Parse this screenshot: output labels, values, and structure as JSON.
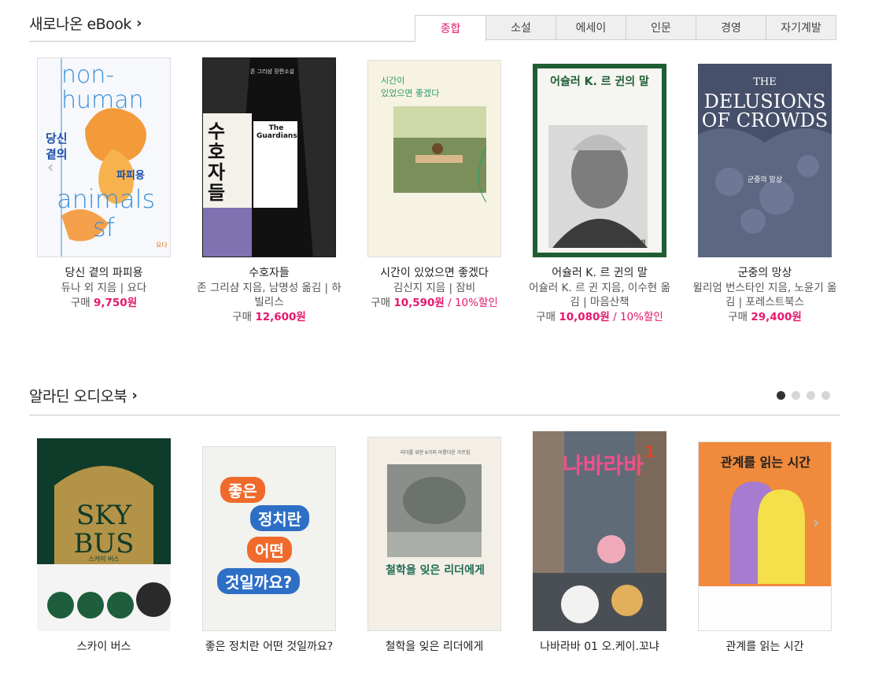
{
  "ebook": {
    "title": "새로나온 eBook",
    "tabs": [
      "종합",
      "소설",
      "에세이",
      "인문",
      "경영",
      "자기계발"
    ],
    "books": [
      {
        "title": "당신 곁의 파피용",
        "author": "듀나 외 지음 | 요다",
        "price_label": "구매",
        "price": "9,750원",
        "discount": ""
      },
      {
        "title": "수호자들",
        "author": "존 그리샴 지음, 남명성 옮김 | 하빌리스",
        "price_label": "구매",
        "price": "12,600원",
        "discount": ""
      },
      {
        "title": "시간이 있었으면 좋겠다",
        "author": "김신지 지음 | 잠비",
        "price_label": "구매",
        "price": "10,590원",
        "discount": " / 10%할인"
      },
      {
        "title": "어슐러 K. 르 귄의 말",
        "author": "어슐러 K. 르 귄 지음, 이수현 옮김 | 마음산책",
        "price_label": "구매",
        "price": "10,080원",
        "discount": " / 10%할인"
      },
      {
        "title": "군중의 망상",
        "author": "윌리엄 번스타인 지음, 노윤기 옮김 | 포레스트북스",
        "price_label": "구매",
        "price": "29,400원",
        "discount": ""
      }
    ],
    "covers": {
      "c1": {
        "lines": [
          "non-",
          "human",
          "당신",
          "곁의",
          "파피용",
          "animals",
          "sf"
        ],
        "brand": "요다"
      },
      "c2": {
        "top": "존 그리샴 장편소설",
        "big": "수호자들",
        "en": "The Guardians"
      },
      "c3": {
        "a": "시간이",
        "b": "있었으면 좋겠다"
      },
      "c4": {
        "t": "어슐러 K. 르 귄의 말",
        "pub": "마음산책"
      },
      "c5": {
        "l1": "THE",
        "l2": "DELUSIONS",
        "l3": "OF CROWDS",
        "ko": "군중의 망상"
      }
    }
  },
  "audio": {
    "title": "알라딘 오디오북",
    "books": [
      {
        "title": "스카이 버스"
      },
      {
        "title": "좋은 정치란 어떤 것일까요?"
      },
      {
        "title": "철학을 잊은 리더에게"
      },
      {
        "title": "나바라바 01 오.케이.꼬냐"
      },
      {
        "title": "관계를 읽는 시간"
      }
    ],
    "covers": {
      "a1": {
        "l1": "SKY",
        "l2": "BUS",
        "sub": "스카이 버스"
      },
      "a2": {
        "w1": "좋은",
        "w2": "정치란",
        "w3": "어떤",
        "w4": "것일까요?"
      },
      "a3": {
        "top": "리더를 위한 6가지 아름다운 가르침",
        "t": "철학을 잊은 리더에게"
      },
      "a4": {
        "t": "나바라바",
        "n": "1"
      },
      "a5": {
        "t": "관계를 읽는 시간"
      }
    }
  },
  "colors": {
    "accent": "#e4186d",
    "dot_active": "#333333",
    "dot_inactive": "#d6d6d6"
  },
  "icons": {
    "chevron": "chevron-right-icon",
    "prev": "chevron-left-icon",
    "next": "chevron-right-icon"
  }
}
